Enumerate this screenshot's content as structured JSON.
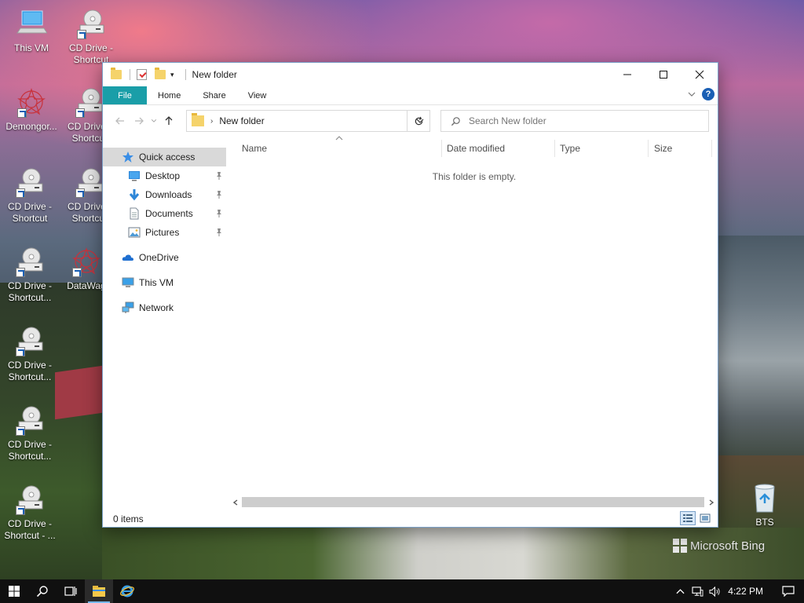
{
  "desktop": {
    "icons": [
      {
        "label": "This VM",
        "kind": "pc"
      },
      {
        "label": "CD Drive - Shortcut",
        "kind": "cd"
      },
      {
        "label": "Demongor...",
        "kind": "star"
      },
      {
        "label": "CD Drive - Shortcut",
        "kind": "cd"
      },
      {
        "label": "CD Drive - Shortcut",
        "kind": "cd"
      },
      {
        "label": "CD Drive - Shortcut",
        "kind": "cd"
      },
      {
        "label": "CD Drive - Shortcut...",
        "kind": "cd"
      },
      {
        "label": "DataWag",
        "kind": "star"
      },
      {
        "label": "CD Drive - Shortcut...",
        "kind": "cd"
      },
      {
        "label": "CD Drive - Shortcut...",
        "kind": "cd"
      },
      {
        "label": "CD Drive - Shortcut - ...",
        "kind": "cd"
      },
      {
        "label": "BTS",
        "kind": "bin"
      }
    ],
    "watermark": "Microsoft Bing"
  },
  "window": {
    "title": "New folder",
    "ribbon": {
      "tabs": [
        "File",
        "Home",
        "Share",
        "View"
      ]
    },
    "address": {
      "path": "New folder"
    },
    "search": {
      "placeholder": "Search New folder"
    },
    "sidebar": {
      "quick_access": "Quick access",
      "pinned": [
        "Desktop",
        "Downloads",
        "Documents",
        "Pictures"
      ],
      "onedrive": "OneDrive",
      "this_pc": "This VM",
      "network": "Network"
    },
    "columns": [
      "Name",
      "Date modified",
      "Type",
      "Size"
    ],
    "empty_message": "This folder is empty.",
    "status": "0 items"
  },
  "taskbar": {
    "time": "4:22 PM"
  },
  "colors": {
    "file_tab": "#1a9ea8",
    "accent": "#1a5fb4",
    "folder": "#f5d36b",
    "taskbar": "#101010"
  }
}
